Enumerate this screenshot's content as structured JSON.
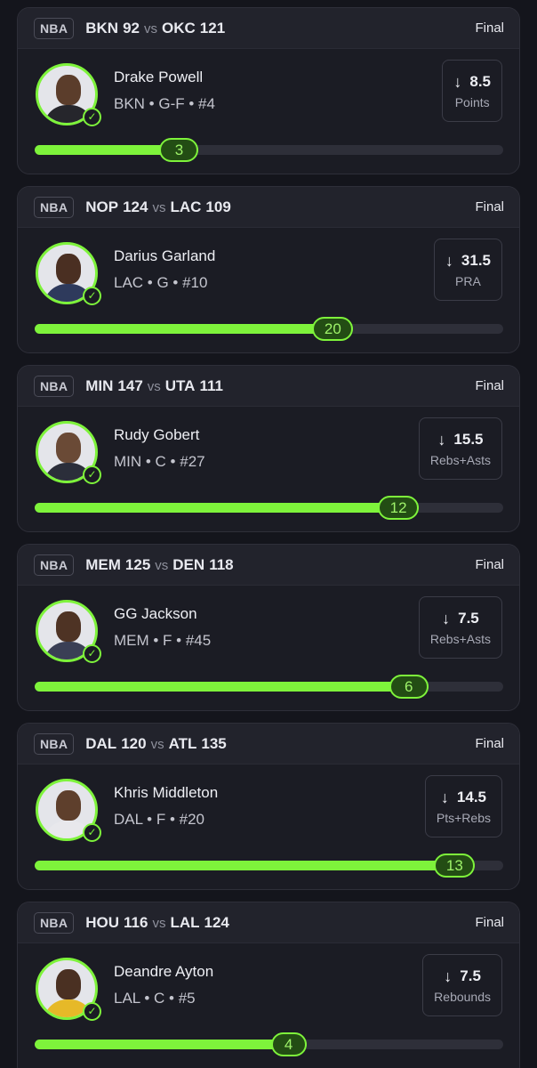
{
  "theme": {
    "accent": "#7ef33b",
    "background": "#14151c",
    "card": "#1b1c24"
  },
  "cards": [
    {
      "league": "NBA",
      "team1": "BKN",
      "score1": "92",
      "vs": "vs",
      "team2": "OKC",
      "score2": "121",
      "status": "Final",
      "player": "Drake Powell",
      "meta": "BKN • G-F • #4",
      "direction_icon": "arrow-down-icon",
      "line": "8.5",
      "stat": "Points",
      "actual": "3",
      "progress": 0.35
    },
    {
      "league": "NBA",
      "team1": "NOP",
      "score1": "124",
      "vs": "vs",
      "team2": "LAC",
      "score2": "109",
      "status": "Final",
      "player": "Darius Garland",
      "meta": "LAC • G • #10",
      "direction_icon": "arrow-down-icon",
      "line": "31.5",
      "stat": "PRA",
      "actual": "20",
      "progress": 0.68
    },
    {
      "league": "NBA",
      "team1": "MIN",
      "score1": "147",
      "vs": "vs",
      "team2": "UTA",
      "score2": "111",
      "status": "Final",
      "player": "Rudy Gobert",
      "meta": "MIN • C • #27",
      "direction_icon": "arrow-down-icon",
      "line": "15.5",
      "stat": "Rebs+Asts",
      "actual": "12",
      "progress": 0.82
    },
    {
      "league": "NBA",
      "team1": "MEM",
      "score1": "125",
      "vs": "vs",
      "team2": "DEN",
      "score2": "118",
      "status": "Final",
      "player": "GG Jackson",
      "meta": "MEM • F • #45",
      "direction_icon": "arrow-down-icon",
      "line": "7.5",
      "stat": "Rebs+Asts",
      "actual": "6",
      "progress": 0.84
    },
    {
      "league": "NBA",
      "team1": "DAL",
      "score1": "120",
      "vs": "vs",
      "team2": "ATL",
      "score2": "135",
      "status": "Final",
      "player": "Khris Middleton",
      "meta": "DAL • F • #20",
      "direction_icon": "arrow-down-icon",
      "line": "14.5",
      "stat": "Pts+Rebs",
      "actual": "13",
      "progress": 0.94
    },
    {
      "league": "NBA",
      "team1": "HOU",
      "score1": "116",
      "vs": "vs",
      "team2": "LAL",
      "score2": "124",
      "status": "Final",
      "player": "Deandre Ayton",
      "meta": "LAL • C • #5",
      "direction_icon": "arrow-down-icon",
      "line": "7.5",
      "stat": "Rebounds",
      "actual": "4",
      "progress": 0.58
    }
  ]
}
